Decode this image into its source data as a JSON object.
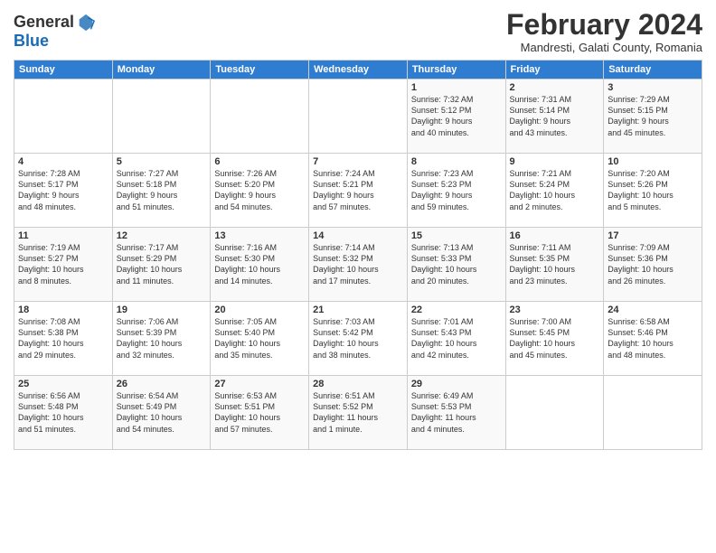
{
  "header": {
    "logo_line1": "General",
    "logo_line2": "Blue",
    "month": "February 2024",
    "location": "Mandresti, Galati County, Romania"
  },
  "weekdays": [
    "Sunday",
    "Monday",
    "Tuesday",
    "Wednesday",
    "Thursday",
    "Friday",
    "Saturday"
  ],
  "rows": [
    [
      {
        "day": "",
        "info": ""
      },
      {
        "day": "",
        "info": ""
      },
      {
        "day": "",
        "info": ""
      },
      {
        "day": "",
        "info": ""
      },
      {
        "day": "1",
        "info": "Sunrise: 7:32 AM\nSunset: 5:12 PM\nDaylight: 9 hours\nand 40 minutes."
      },
      {
        "day": "2",
        "info": "Sunrise: 7:31 AM\nSunset: 5:14 PM\nDaylight: 9 hours\nand 43 minutes."
      },
      {
        "day": "3",
        "info": "Sunrise: 7:29 AM\nSunset: 5:15 PM\nDaylight: 9 hours\nand 45 minutes."
      }
    ],
    [
      {
        "day": "4",
        "info": "Sunrise: 7:28 AM\nSunset: 5:17 PM\nDaylight: 9 hours\nand 48 minutes."
      },
      {
        "day": "5",
        "info": "Sunrise: 7:27 AM\nSunset: 5:18 PM\nDaylight: 9 hours\nand 51 minutes."
      },
      {
        "day": "6",
        "info": "Sunrise: 7:26 AM\nSunset: 5:20 PM\nDaylight: 9 hours\nand 54 minutes."
      },
      {
        "day": "7",
        "info": "Sunrise: 7:24 AM\nSunset: 5:21 PM\nDaylight: 9 hours\nand 57 minutes."
      },
      {
        "day": "8",
        "info": "Sunrise: 7:23 AM\nSunset: 5:23 PM\nDaylight: 9 hours\nand 59 minutes."
      },
      {
        "day": "9",
        "info": "Sunrise: 7:21 AM\nSunset: 5:24 PM\nDaylight: 10 hours\nand 2 minutes."
      },
      {
        "day": "10",
        "info": "Sunrise: 7:20 AM\nSunset: 5:26 PM\nDaylight: 10 hours\nand 5 minutes."
      }
    ],
    [
      {
        "day": "11",
        "info": "Sunrise: 7:19 AM\nSunset: 5:27 PM\nDaylight: 10 hours\nand 8 minutes."
      },
      {
        "day": "12",
        "info": "Sunrise: 7:17 AM\nSunset: 5:29 PM\nDaylight: 10 hours\nand 11 minutes."
      },
      {
        "day": "13",
        "info": "Sunrise: 7:16 AM\nSunset: 5:30 PM\nDaylight: 10 hours\nand 14 minutes."
      },
      {
        "day": "14",
        "info": "Sunrise: 7:14 AM\nSunset: 5:32 PM\nDaylight: 10 hours\nand 17 minutes."
      },
      {
        "day": "15",
        "info": "Sunrise: 7:13 AM\nSunset: 5:33 PM\nDaylight: 10 hours\nand 20 minutes."
      },
      {
        "day": "16",
        "info": "Sunrise: 7:11 AM\nSunset: 5:35 PM\nDaylight: 10 hours\nand 23 minutes."
      },
      {
        "day": "17",
        "info": "Sunrise: 7:09 AM\nSunset: 5:36 PM\nDaylight: 10 hours\nand 26 minutes."
      }
    ],
    [
      {
        "day": "18",
        "info": "Sunrise: 7:08 AM\nSunset: 5:38 PM\nDaylight: 10 hours\nand 29 minutes."
      },
      {
        "day": "19",
        "info": "Sunrise: 7:06 AM\nSunset: 5:39 PM\nDaylight: 10 hours\nand 32 minutes."
      },
      {
        "day": "20",
        "info": "Sunrise: 7:05 AM\nSunset: 5:40 PM\nDaylight: 10 hours\nand 35 minutes."
      },
      {
        "day": "21",
        "info": "Sunrise: 7:03 AM\nSunset: 5:42 PM\nDaylight: 10 hours\nand 38 minutes."
      },
      {
        "day": "22",
        "info": "Sunrise: 7:01 AM\nSunset: 5:43 PM\nDaylight: 10 hours\nand 42 minutes."
      },
      {
        "day": "23",
        "info": "Sunrise: 7:00 AM\nSunset: 5:45 PM\nDaylight: 10 hours\nand 45 minutes."
      },
      {
        "day": "24",
        "info": "Sunrise: 6:58 AM\nSunset: 5:46 PM\nDaylight: 10 hours\nand 48 minutes."
      }
    ],
    [
      {
        "day": "25",
        "info": "Sunrise: 6:56 AM\nSunset: 5:48 PM\nDaylight: 10 hours\nand 51 minutes."
      },
      {
        "day": "26",
        "info": "Sunrise: 6:54 AM\nSunset: 5:49 PM\nDaylight: 10 hours\nand 54 minutes."
      },
      {
        "day": "27",
        "info": "Sunrise: 6:53 AM\nSunset: 5:51 PM\nDaylight: 10 hours\nand 57 minutes."
      },
      {
        "day": "28",
        "info": "Sunrise: 6:51 AM\nSunset: 5:52 PM\nDaylight: 11 hours\nand 1 minute."
      },
      {
        "day": "29",
        "info": "Sunrise: 6:49 AM\nSunset: 5:53 PM\nDaylight: 11 hours\nand 4 minutes."
      },
      {
        "day": "",
        "info": ""
      },
      {
        "day": "",
        "info": ""
      }
    ]
  ]
}
